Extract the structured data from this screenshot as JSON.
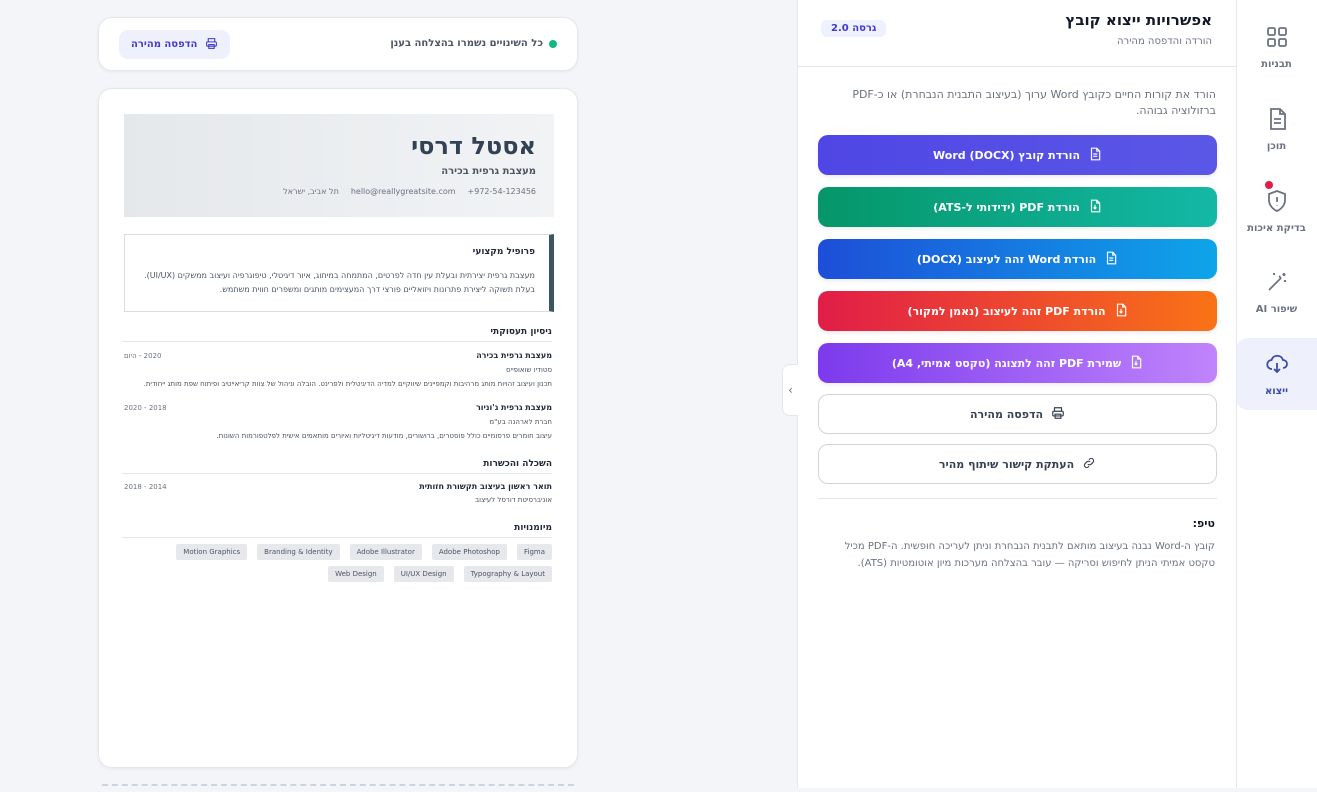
{
  "rail": {
    "items": [
      {
        "label": "תבניות"
      },
      {
        "label": "תוכן"
      },
      {
        "label": "בדיקת איכות"
      },
      {
        "label": "שיפור AI"
      },
      {
        "label": "ייצוא"
      }
    ]
  },
  "panel": {
    "title": "אפשרויות ייצוא קובץ",
    "subtitle": "הורדה והדפסה מהירה",
    "version": "גרסה 2.0",
    "description": "הורד את קורות החיים כקובץ Word ערוך (בעיצוב התבנית הנבחרת) או כ-PDF ברזולוציה גבוהה.",
    "buttons": [
      {
        "label": "הורדת קובץ Word (DOCX)",
        "icon": "file-doc-icon",
        "color_from": "#4f46e5",
        "color_to": "#5b57e6"
      },
      {
        "label": "הורדת PDF (ידידותי ל-ATS)",
        "icon": "file-download-icon",
        "color_from": "#059669",
        "color_to": "#14b8a6"
      },
      {
        "label": "הורדת Word זהה לעיצוב (DOCX)",
        "icon": "file-doc-icon",
        "color_from": "#1d4ed8",
        "color_to": "#0ea5e9"
      },
      {
        "label": "הורדת PDF זהה לעיצוב (נאמן למקור)",
        "icon": "file-download-icon",
        "color_from": "#e11d48",
        "color_to": "#f97316"
      },
      {
        "label": "שמירת PDF זהה לתצוגה (טקסט אמיתי, A4)",
        "icon": "file-download-icon",
        "color_from": "#7c3aed",
        "color_to": "#c084fc"
      },
      {
        "label": "הדפסה מהירה",
        "icon": "printer-icon"
      },
      {
        "label": "העתקת קישור שיתוף מהיר",
        "icon": "link-icon"
      }
    ],
    "tip_title": "טיפ:",
    "tip_text": "קובץ ה-Word נבנה בעיצוב מותאם לתבנית הנבחרת וניתן לעריכה חופשית. ה-PDF מכיל טקסט אמיתי הניתן לחיפוש וסריקה — עובר בהצלחה מערכות מיון אוטומטיות (ATS)."
  },
  "topbar": {
    "status": "כל השינויים נשמרו בהצלחה בענן",
    "quick_print": "הדפסה מהירה"
  },
  "resume": {
    "name": "אסטל דרסי",
    "role": "מעצבת גרפית בכירה",
    "phone": "+972-54-123456",
    "email": "hello@reallygreatsite.com",
    "location": "תל אביב, ישראל",
    "profile_title": "פרופיל מקצועי",
    "profile_text": "מעצבת גרפית יצירתית ובעלת עין חדה לפרטים, המתמחה במיתוג, איור דיגיטלי, טיפוגרפיה ועיצוב ממשקים (UI/UX). בעלת תשוקה ליצירת פתרונות ויזואליים פורצי דרך המעצימים מותגים ומשפרים חווית משתמש.",
    "experience_title": "ניסיון תעסוקתי",
    "jobs": [
      {
        "title": "מעצבת גרפית בכירה",
        "date": "2020 - היום",
        "company": "סטודיו שואופייס",
        "desc": "תכנון ועיצוב זהויות מותג מרהיבות וקמפיינים שיווקיים למדיה הדיגיטלית ולפרינט. הובלה וניהול של צוות קריאייטיב ופיתוח שפת מותג ייחודית."
      },
      {
        "title": "מעצבת גרפית ג'וניור",
        "date": "2018 - 2020",
        "company": "חברת לארהנה בע\"מ",
        "desc": "עיצוב חומרים פרסומיים כולל פוסטרים, ברושורים, מודעות דיגיטליות ואיורים מותאמים אישית לפלטפורמות השונות."
      }
    ],
    "education_title": "השכלה והכשרות",
    "education": {
      "title": "תואר ראשון בעיצוב תקשורת חזותית",
      "date": "2014 - 2018",
      "school": "אוניברסיטת דורסל לעיצוב"
    },
    "skills_title": "מיומנויות",
    "skills": [
      "Figma",
      "Adobe Photoshop",
      "Adobe Illustrator",
      "Branding & Identity",
      "Motion Graphics",
      "Typography & Layout",
      "UI/UX Design",
      "Web Design"
    ]
  }
}
